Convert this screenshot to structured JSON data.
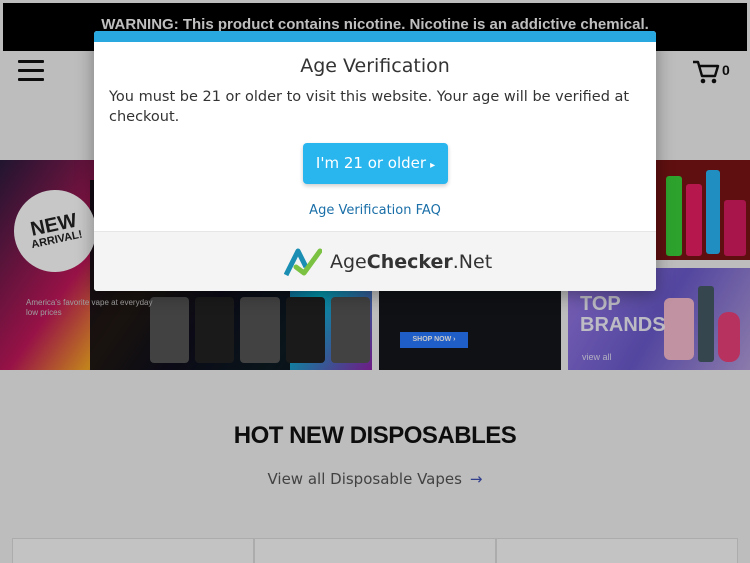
{
  "warning_banner": "WARNING: This product contains nicotine. Nicotine is an addictive chemical.",
  "header": {
    "cart_count": "0"
  },
  "hero": {
    "new_badge_line1": "NEW",
    "new_badge_line2": "ARRIVAL!",
    "mid_banner_text": "America's favorite vape at everyday low prices",
    "shop_now_label": "SHOP NOW ›",
    "brands_title_line1": "TOP",
    "brands_title_line2": "BRANDS",
    "brands_view_all": "view all"
  },
  "section": {
    "title": "HOT NEW DISPOSABLES",
    "view_all_link": "View all Disposable Vapes",
    "arrow": "→"
  },
  "modal": {
    "title": "Age Verification",
    "message": "You must be 21 or older to visit this website. Your age will be verified at checkout.",
    "confirm_label": "I'm 21 or older",
    "confirm_caret": "▸",
    "faq_link": "Age Verification FAQ",
    "brand_prefix": "Age",
    "brand_bold": "Checker",
    "brand_suffix": ".Net"
  },
  "colors": {
    "modal_accent": "#29a8e0",
    "button": "#29b6ef",
    "faq_link": "#1a6fa8",
    "logo_green": "#7cc242",
    "logo_teal": "#1b8fb3"
  },
  "icons": [
    "hamburger-menu-icon",
    "cart-icon",
    "arrow-right-icon",
    "agechecker-logo-icon"
  ]
}
